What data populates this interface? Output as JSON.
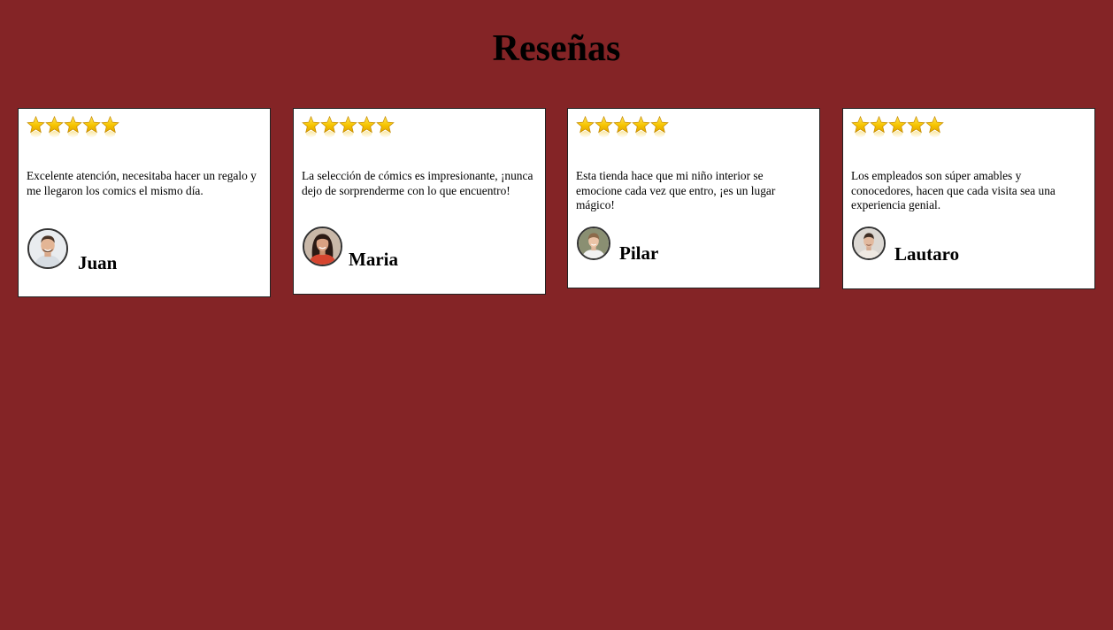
{
  "page": {
    "title": "Reseñas",
    "background": "#842426"
  },
  "reviews": [
    {
      "text": "Excelente atención, necesitaba hacer un regalo y me llegaron los comics el mismo día.",
      "name": "Juan",
      "rating": 5,
      "avatar": "man-smiling-avatar"
    },
    {
      "text": "La selección de cómics es impresionante, ¡nunca dejo de sorprenderme con lo que encuentro!",
      "name": "Maria",
      "rating": 5,
      "avatar": "woman-dark-hair-avatar"
    },
    {
      "text": "Esta tienda hace que mi niño interior se emocione cada vez que entro, ¡es un lugar mágico!",
      "name": "Pilar",
      "rating": 5,
      "avatar": "woman-light-hair-avatar"
    },
    {
      "text": "Los empleados son súper amables y conocedores, hacen que cada visita sea una experiencia genial.",
      "name": "Lautaro",
      "rating": 5,
      "avatar": "man-short-hair-avatar"
    }
  ],
  "colors": {
    "star": "#f6c400",
    "card": "#ffffff"
  }
}
